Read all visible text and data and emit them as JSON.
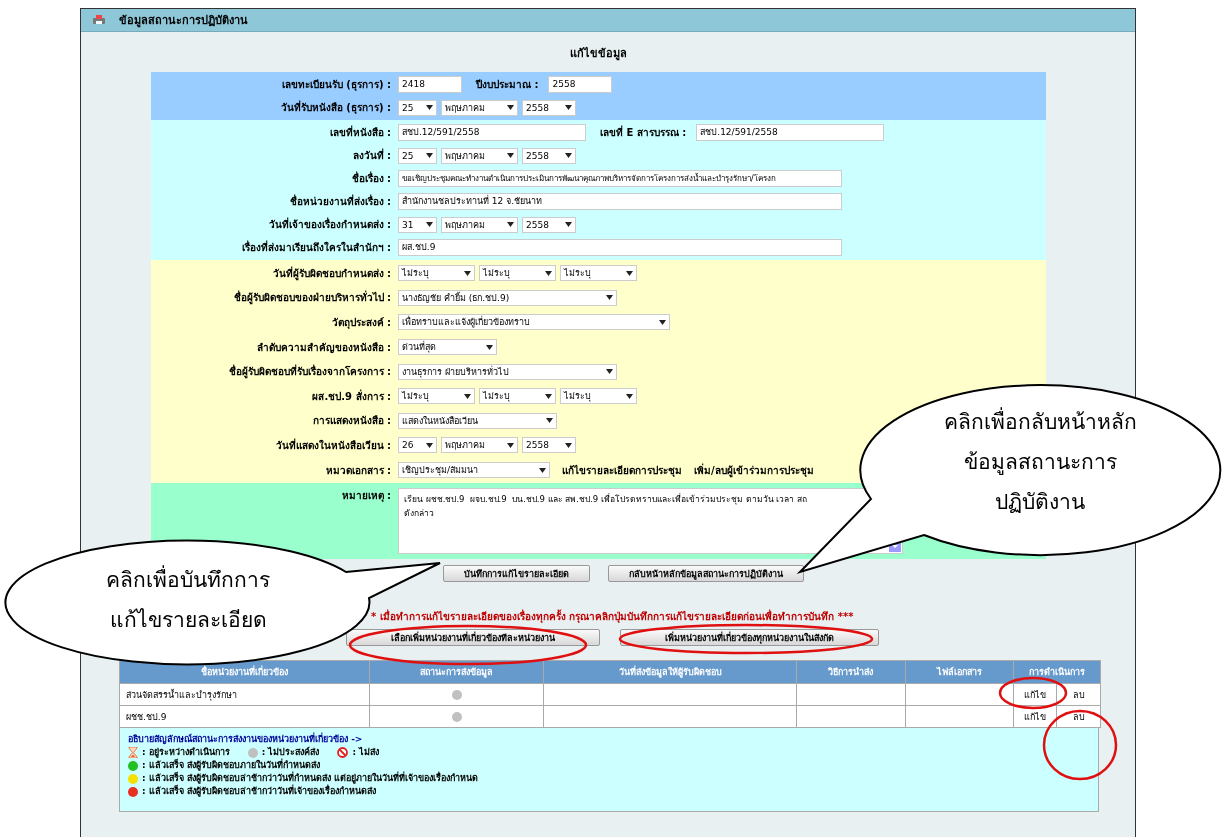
{
  "window": {
    "title": "ข้อมูลสถานะการปฏิบัติงาน"
  },
  "heading": "แก้ไขข้อมูล",
  "sections": [
    {
      "kind": "blue",
      "rows": [
        {
          "label": "เลขทะเบียนรับ (ธุรการ) :",
          "fields": [
            {
              "kind": "text",
              "value": "2418"
            },
            {
              "kind": "label",
              "text": "ปีงบประมาณ :"
            },
            {
              "kind": "text",
              "value": "2558"
            }
          ]
        },
        {
          "label": "วันที่รับหนังสือ (ธุรการ) :",
          "fields": [
            {
              "kind": "select",
              "value": "25"
            },
            {
              "kind": "select",
              "value": "พฤษภาคม"
            },
            {
              "kind": "select",
              "value": "2558"
            }
          ]
        }
      ]
    },
    {
      "kind": "cyan",
      "rows": [
        {
          "label": "เลขที่หนังสือ :",
          "fields": [
            {
              "kind": "text",
              "value": "สชป.12/591/2558"
            },
            {
              "kind": "label",
              "text": "เลขที่ E สารบรรณ :"
            },
            {
              "kind": "text",
              "value": "สชป.12/591/2558"
            }
          ]
        },
        {
          "label": "ลงวันที่ :",
          "fields": [
            {
              "kind": "select",
              "value": "25"
            },
            {
              "kind": "select",
              "value": "พฤษภาคม"
            },
            {
              "kind": "select",
              "value": "2558"
            }
          ]
        },
        {
          "label": "ชื่อเรื่อง :",
          "fields": [
            {
              "kind": "text",
              "value": "ขอเชิญประชุมคณะทำงานดำเนินการประเมินการพัฒนาคุณภาพบริหารจัดการโครงการส่งน้ำและบำรุงรักษา/โครงก"
            }
          ]
        },
        {
          "label": "ชื่อหน่วยงานที่ส่งเรื่อง :",
          "fields": [
            {
              "kind": "text",
              "value": "สำนักงานชลประทานที่ 12 จ.ชัยนาท"
            }
          ]
        },
        {
          "label": "วันที่เจ้าของเรื่องกำหนดส่ง :",
          "fields": [
            {
              "kind": "select",
              "value": "31"
            },
            {
              "kind": "select",
              "value": "พฤษภาคม"
            },
            {
              "kind": "select",
              "value": "2558"
            }
          ]
        },
        {
          "label": "เรื่องที่ส่งมาเรียนถึงใครในสำนักฯ :",
          "fields": [
            {
              "kind": "text",
              "value": "ผส.ชป.9"
            }
          ]
        }
      ]
    },
    {
      "kind": "yellow",
      "rows": [
        {
          "label": "วันที่ผู้รับผิดชอบกำหนดส่ง :",
          "fields": [
            {
              "kind": "select",
              "value": "ไม่ระบุ"
            },
            {
              "kind": "select",
              "value": "ไม่ระบุ"
            },
            {
              "kind": "select",
              "value": "ไม่ระบุ"
            }
          ]
        },
        {
          "label": "ชื่อผู้รับผิดชอบของฝ่ายบริหารทั่วไป :",
          "fields": [
            {
              "kind": "select",
              "value": "นางธัญชัย คำยิ้ม (ธก.ชป.9)"
            }
          ]
        },
        {
          "label": "วัตถุประสงค์ :",
          "fields": [
            {
              "kind": "select",
              "value": "เพื่อทราบและแจ้งผู้เกี่ยวข้องทราบ"
            }
          ]
        },
        {
          "label": "ลำดับความสำคัญของหนังสือ :",
          "fields": [
            {
              "kind": "select",
              "value": "ด่วนที่สุด"
            }
          ]
        },
        {
          "label": "ชื่อผู้รับผิดชอบที่รับเรื่องจากโครงการ :",
          "fields": [
            {
              "kind": "select",
              "value": "งานธุรการ ฝ่ายบริหารทั่วไป"
            }
          ]
        },
        {
          "label": "ผส.ชป.9 สั่งการ :",
          "fields": [
            {
              "kind": "select",
              "value": "ไม่ระบุ"
            },
            {
              "kind": "select",
              "value": "ไม่ระบุ"
            },
            {
              "kind": "select",
              "value": "ไม่ระบุ"
            }
          ]
        },
        {
          "label": "การแสดงหนังสือ :",
          "fields": [
            {
              "kind": "select",
              "value": "แสดงในหนังสือเวียน"
            }
          ]
        },
        {
          "label": "วันที่แสดงในหนังสือเวียน :",
          "fields": [
            {
              "kind": "select",
              "value": "26"
            },
            {
              "kind": "select",
              "value": "พฤษภาคม"
            },
            {
              "kind": "select",
              "value": "2558"
            }
          ]
        },
        {
          "label": "หมวดเอกสาร :",
          "fields": [
            {
              "kind": "select",
              "value": "เชิญประชุม/สัมมนา"
            },
            {
              "kind": "link",
              "text": "แก้ไขรายละเอียดการประชุม"
            },
            {
              "kind": "link",
              "text": "เพิ่ม/ลบผู้เข้าร่วมการประชุม"
            }
          ]
        }
      ]
    },
    {
      "kind": "green",
      "rows": [
        {
          "label": "หมายเหตุ :",
          "fields": [
            {
              "kind": "textarea",
              "value": "เรียน ผชช.ชป.9  ผจบ.ชป.9  บน.ชป.9 และ สพ.ชป.9 เพื่อโปรดทราบและเพื่อเข้าร่วมประชุม ตามวัน เวลา สถ\nดังกล่าว"
            }
          ]
        }
      ]
    }
  ],
  "form_buttons": [
    "บันทึกการแก้ไขรายละเอียด",
    "กลับหน้าหลักข้อมูลสถานะการปฏิบัติงาน"
  ],
  "note": "* เมื่อทำการแก้ไขรายละเอียดของเรื่องทุกครั้ง กรุณาคลิกปุ่มบันทึกการแก้ไขรายละเอียดก่อนเพื่อทำการบันทึก ***",
  "add_buttons": [
    "เลือกเพิ่มหน่วยงานที่เกี่ยวข้องทีละหน่วยงาน",
    "เพิ่มหน่วยงานที่เกี่ยวข้องทุกหน่วยงานในสังกัด"
  ],
  "table": {
    "columns": [
      "ชื่อหน่วยงานที่เกี่ยวข้อง",
      "สถานะการส่งข้อมูล",
      "วันที่ส่งข้อมูลให้ผู้รับผิดชอบ",
      "วิธีการนำส่ง",
      "ไฟล์เอกสาร",
      "การดำเนินการ"
    ],
    "rows": [
      {
        "name": "ส่วนจัดสรรน้ำและบำรุงรักษา",
        "status": {
          "kind": "dot",
          "color": "#c0c0c0"
        },
        "actions": [
          "แก้ไข",
          "ลบ"
        ]
      },
      {
        "name": "ผชช.ชป.9",
        "status": {
          "kind": "dot",
          "color": "#c0c0c0"
        },
        "actions": [
          "แก้ไข",
          "ลบ"
        ]
      }
    ]
  },
  "legend": {
    "title": "อธิบายสัญลักษณ์สถานะการส่งงานของหน่วยงานที่เกี่ยวข้อง ->",
    "lines": [
      [
        {
          "kind": "hourglass",
          "text": ": อยู่ระหว่างดำเนินการ"
        },
        {
          "kind": "dot",
          "color": "#c0c0c0",
          "text": ": ไม่ประสงค์ส่ง"
        },
        {
          "kind": "forbidden",
          "text": ": ไม่ส่ง"
        }
      ],
      [
        {
          "kind": "dot",
          "color": "#22c022",
          "text": ": แล้วเสร็จ ส่งผู้รับผิดชอบภายในวันที่กำหนดส่ง"
        }
      ],
      [
        {
          "kind": "dot",
          "color": "#f5e000",
          "text": ": แล้วเสร็จ ส่งผู้รับผิดชอบล่าช้ากว่าวันที่กำหนดส่ง แต่อยู่ภายในวันที่ที่เจ้าของเรื่องกำหนด"
        }
      ],
      [
        {
          "kind": "dot",
          "color": "#e83020",
          "text": ": แล้วเสร็จ ส่งผู้รับผิดชอบล่าช้ากว่าวันที่เจ้าของเรื่องกำหนดส่ง"
        }
      ]
    ]
  },
  "callouts": [
    {
      "lines": [
        "คลิกเพื่อกลับหน้าหลัก",
        "ข้อมูลสถานะการ",
        "ปฏิบัติงาน"
      ]
    },
    {
      "lines": [
        "คลิกเพื่อบันทึกการ",
        "แก้ไขรายละเอียด"
      ]
    }
  ]
}
